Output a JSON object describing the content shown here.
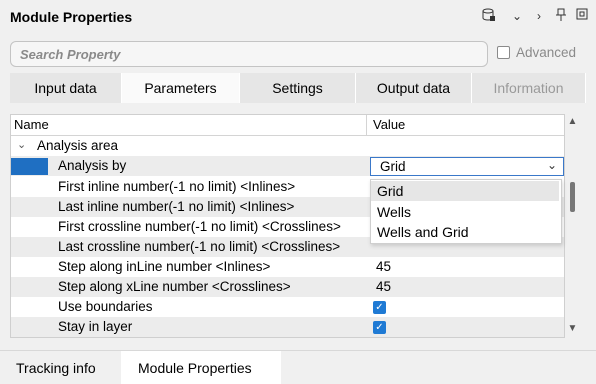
{
  "header": {
    "title": "Module Properties",
    "icons": [
      "database-icon",
      "chevron-down-icon",
      "chevron-right-icon",
      "pin-icon",
      "restore-icon"
    ]
  },
  "search": {
    "placeholder": "Search Property",
    "advanced_label": "Advanced",
    "advanced_checked": false
  },
  "tabs": [
    {
      "label": "Input data",
      "state": "inactive"
    },
    {
      "label": "Parameters",
      "state": "active"
    },
    {
      "label": "Settings",
      "state": "inactive"
    },
    {
      "label": "Output data",
      "state": "inactive"
    },
    {
      "label": "Information",
      "state": "disabled"
    }
  ],
  "grid": {
    "col_name": "Name",
    "col_value": "Value",
    "group": "Analysis area",
    "rows": [
      {
        "name": "Analysis by",
        "value": "Grid",
        "kind": "combo"
      },
      {
        "name": "First inline number(-1 no limit) <Inlines>",
        "value": "",
        "kind": "text"
      },
      {
        "name": "Last inline number(-1 no limit) <Inlines>",
        "value": "",
        "kind": "text"
      },
      {
        "name": "First crossline number(-1 no limit) <Crosslines>",
        "value": "",
        "kind": "text"
      },
      {
        "name": "Last crossline number(-1 no limit) <Crosslines>",
        "value": "",
        "kind": "text"
      },
      {
        "name": "Step along inLine number <Inlines>",
        "value": "45",
        "kind": "text"
      },
      {
        "name": "Step along xLine number <Crosslines>",
        "value": "45",
        "kind": "text"
      },
      {
        "name": "Use boundaries",
        "value": "",
        "kind": "check",
        "checked": true
      },
      {
        "name": "Stay in layer",
        "value": "",
        "kind": "check",
        "checked": true
      }
    ]
  },
  "dropdown": {
    "options": [
      "Grid",
      "Wells",
      "Wells and Grid"
    ],
    "highlighted": 0
  },
  "bottom_tabs": [
    {
      "label": "Tracking info",
      "active": false
    },
    {
      "label": "Module Properties",
      "active": true
    }
  ],
  "colors": {
    "accent": "#1f7ad4",
    "selection": "#1f6fc2",
    "disabled_text": "#9a9a9a"
  }
}
